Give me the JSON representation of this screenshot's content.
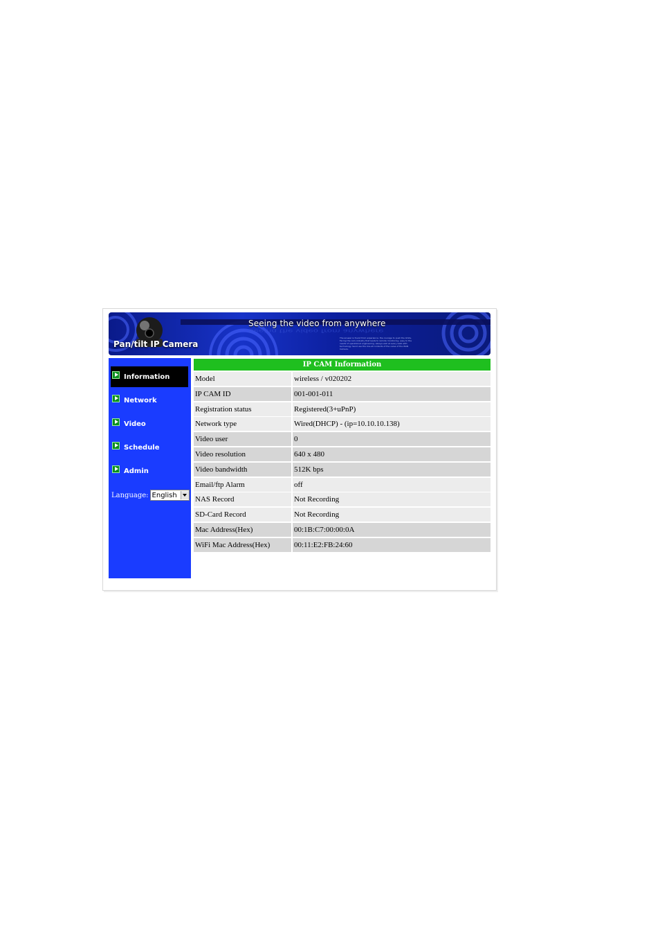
{
  "banner": {
    "tagline": "Seeing the video from anywhere",
    "title": "Pan/tilt IP Camera",
    "fine_print": "The answer is found from experience. the courage to push the limits. Facing the cam-industry that leads to remote monitoring, easy to the needs of operational engineering, always well at every walk with technology. Send use the low-all contents of the value of the WAN Camera."
  },
  "sidebar": {
    "items": [
      {
        "label": "Information",
        "icon": "play-arrow-icon",
        "active": true
      },
      {
        "label": "Network",
        "icon": "play-arrow-icon",
        "active": false
      },
      {
        "label": "Video",
        "icon": "play-arrow-icon",
        "active": false
      },
      {
        "label": "Schedule",
        "icon": "play-arrow-icon",
        "active": false
      },
      {
        "label": "Admin",
        "icon": "play-arrow-icon",
        "active": false
      }
    ],
    "language_label": "Language:",
    "language_value": "English"
  },
  "info": {
    "title": "IP CAM Information",
    "rows": [
      {
        "key": "Model",
        "value": "wireless / v020202"
      },
      {
        "key": "IP CAM ID",
        "value": "001-001-011"
      },
      {
        "key": "Registration status",
        "value": "Registered(3+uPnP)"
      },
      {
        "key": "Network type",
        "value": "Wired(DHCP) - (ip=10.10.10.138)"
      },
      {
        "key": "Video user",
        "value": "0"
      },
      {
        "key": "Video resolution",
        "value": "640 x 480"
      },
      {
        "key": "Video bandwidth",
        "value": "512K bps"
      },
      {
        "key": "Email/ftp Alarm",
        "value": "off"
      },
      {
        "key": "NAS Record",
        "value": "Not Recording"
      },
      {
        "key": "SD-Card Record",
        "value": "Not Recording"
      },
      {
        "key": "Mac Address(Hex)",
        "value": "00:1B:C7:00:00:0A"
      },
      {
        "key": "WiFi Mac Address(Hex)",
        "value": "00:11:E2:FB:24:60"
      }
    ]
  },
  "colors": {
    "sidebar_bg": "#1a3cff",
    "header_green": "#1fbf1f",
    "row_light": "#ececec",
    "row_dark": "#d6d6d6"
  }
}
